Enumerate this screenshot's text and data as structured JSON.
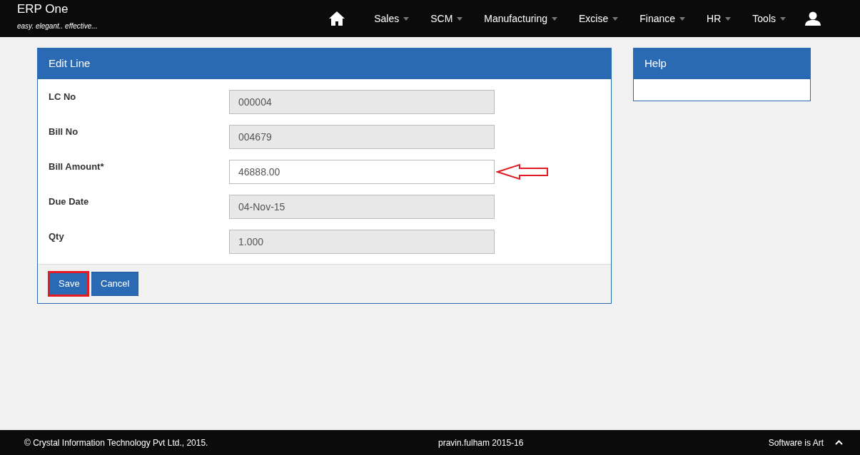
{
  "brand": {
    "title": "ERP One",
    "tagline": "easy. elegant.. effective..."
  },
  "nav": [
    "Sales",
    "SCM",
    "Manufacturing",
    "Excise",
    "Finance",
    "HR",
    "Tools"
  ],
  "form": {
    "title": "Edit Line",
    "fields": [
      {
        "label": "LC No",
        "value": "000004",
        "disabled": true,
        "annotated": false
      },
      {
        "label": "Bill No",
        "value": "004679",
        "disabled": true,
        "annotated": false
      },
      {
        "label": "Bill Amount*",
        "value": "46888.00",
        "disabled": false,
        "annotated": true
      },
      {
        "label": "Due Date",
        "value": "04-Nov-15",
        "disabled": true,
        "annotated": false
      },
      {
        "label": "Qty",
        "value": "1.000",
        "disabled": true,
        "annotated": false
      }
    ],
    "buttons": [
      {
        "label": "Save",
        "highlighted": true
      },
      {
        "label": "Cancel",
        "highlighted": false
      }
    ]
  },
  "help": {
    "title": "Help"
  },
  "footer": {
    "copyright": "© Crystal Information Technology Pvt Ltd., 2015.",
    "user": "pravin.fulham 2015-16",
    "slogan": "Software is Art"
  }
}
